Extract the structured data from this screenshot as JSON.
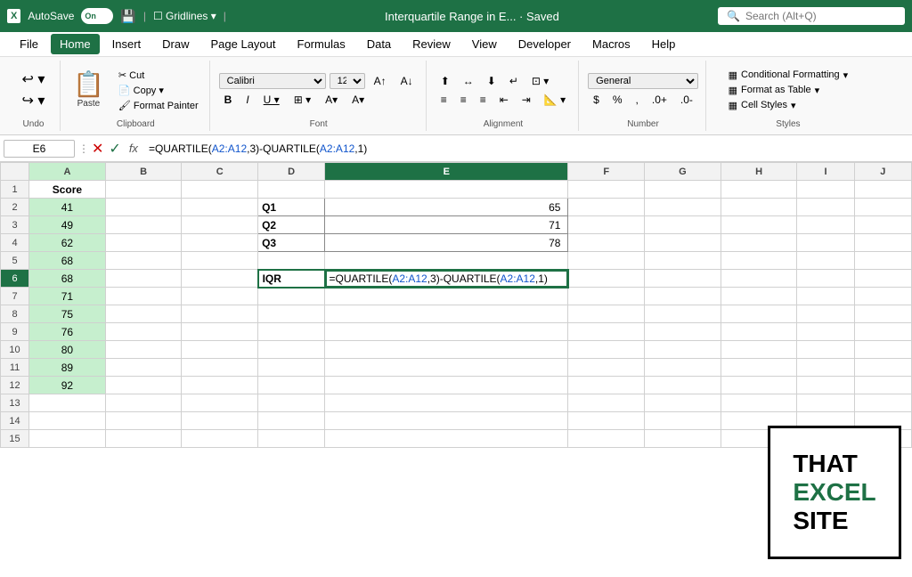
{
  "topbar": {
    "logo": "X",
    "autosave_label": "AutoSave",
    "autosave_state": "On",
    "title": "Interquartile Range in E...  ·  Saved",
    "search_placeholder": "Search (Alt+Q)"
  },
  "menubar": {
    "items": [
      "File",
      "Home",
      "Insert",
      "Draw",
      "Page Layout",
      "Formulas",
      "Data",
      "Review",
      "View",
      "Developer",
      "Macros",
      "Help"
    ],
    "active": "Home"
  },
  "ribbon": {
    "undo_label": "Undo",
    "clipboard_label": "Clipboard",
    "paste_label": "Paste",
    "font_label": "Font",
    "alignment_label": "Alignment",
    "number_label": "Number",
    "styles_label": "Styles",
    "font_name": "Calibri",
    "font_size": "12",
    "conditional_formatting": "Conditional Formatting",
    "format_as_table": "Format as Table",
    "cell_styles": "Cell Styles"
  },
  "formula_bar": {
    "cell_ref": "E6",
    "formula": "=QUARTILE(A2:A12,3)-QUARTILE(A2:A12,1)",
    "formula_parts": {
      "prefix": "=QUARTILE(",
      "ref1": "A2:A12",
      "middle": ",3)-QUARTILE(",
      "ref2": "A2:A12",
      "suffix": ",1)"
    }
  },
  "spreadsheet": {
    "columns": [
      "",
      "A",
      "B",
      "C",
      "D",
      "E",
      "F",
      "G",
      "H",
      "I",
      "J"
    ],
    "rows": [
      {
        "row": 1,
        "a": "Score",
        "d": "",
        "e": ""
      },
      {
        "row": 2,
        "a": "41",
        "d": "Q1",
        "e": "65"
      },
      {
        "row": 3,
        "a": "49",
        "d": "Q2",
        "e": "71"
      },
      {
        "row": 4,
        "a": "62",
        "d": "Q3",
        "e": "78"
      },
      {
        "row": 5,
        "a": "68",
        "d": "",
        "e": ""
      },
      {
        "row": 6,
        "a": "68",
        "d": "IQR",
        "e": "=QUARTILE(A2:A12,3)-QUARTILE(A2:A12,1)"
      },
      {
        "row": 7,
        "a": "71",
        "d": "",
        "e": ""
      },
      {
        "row": 8,
        "a": "75",
        "d": "",
        "e": ""
      },
      {
        "row": 9,
        "a": "76",
        "d": "",
        "e": ""
      },
      {
        "row": 10,
        "a": "80",
        "d": "",
        "e": ""
      },
      {
        "row": 11,
        "a": "89",
        "d": "",
        "e": ""
      },
      {
        "row": 12,
        "a": "92",
        "d": "",
        "e": ""
      },
      {
        "row": 13,
        "a": "",
        "d": "",
        "e": ""
      },
      {
        "row": 14,
        "a": "",
        "d": "",
        "e": ""
      },
      {
        "row": 15,
        "a": "",
        "d": "",
        "e": ""
      }
    ]
  },
  "logo": {
    "line1": "THAT",
    "line2_green": "EXCEL",
    "line3": "SITE"
  }
}
